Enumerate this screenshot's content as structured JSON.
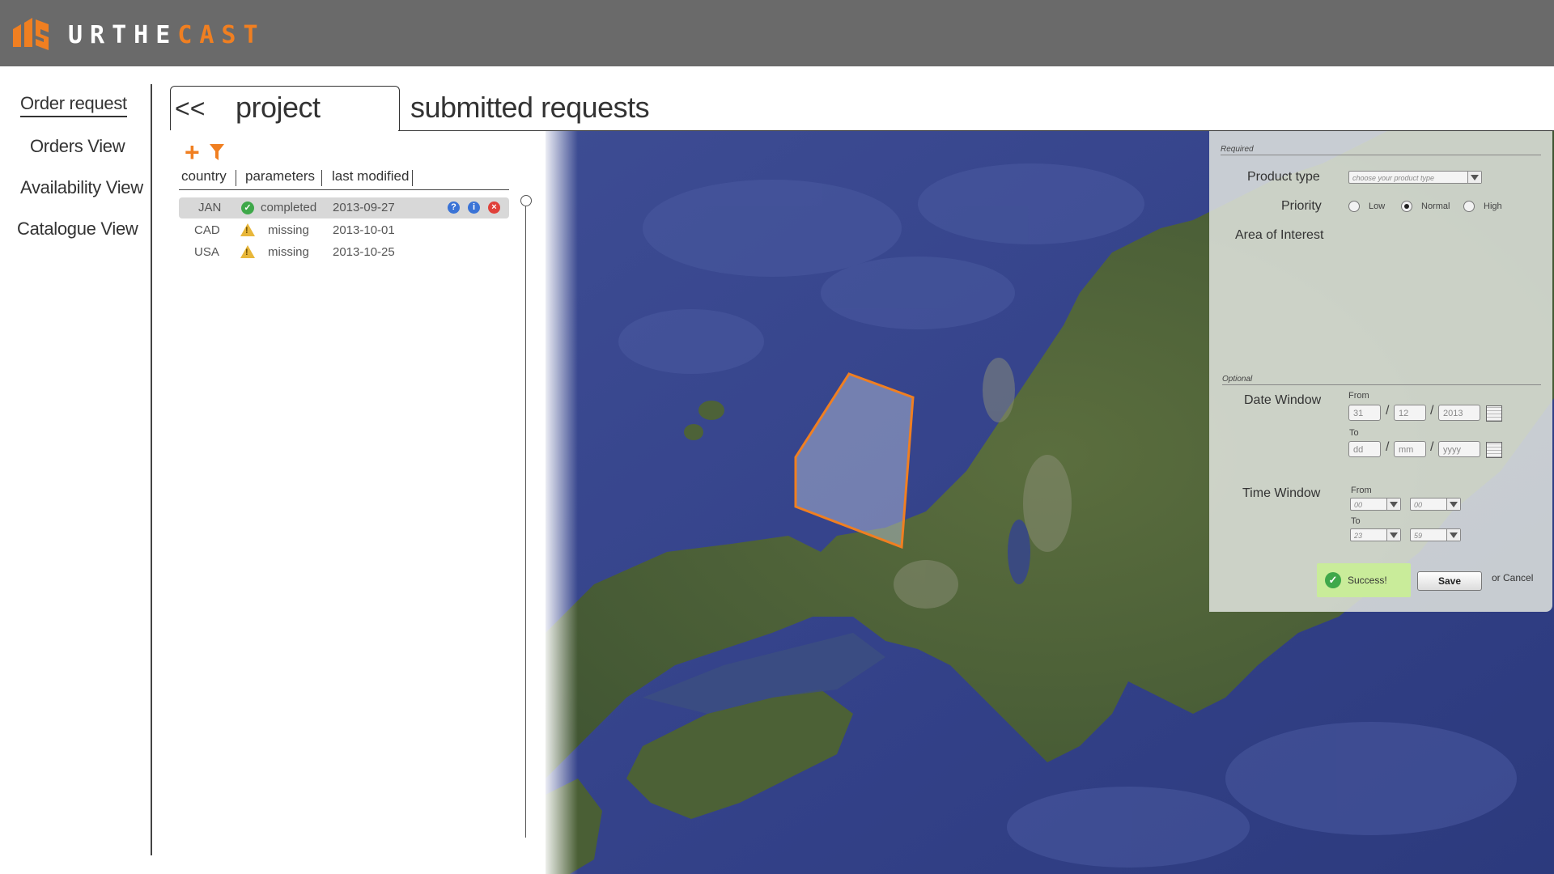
{
  "brand": {
    "logo_white": "URTHE",
    "logo_orange": "CAST",
    "accent": "#f07f21"
  },
  "nav": {
    "items": [
      {
        "label": "Order request",
        "active": true
      },
      {
        "label": "Orders View"
      },
      {
        "label": "Availability View"
      },
      {
        "label": "Catalogue View"
      }
    ]
  },
  "tabs": {
    "back": "<<",
    "project": "project",
    "submitted": "submitted requests"
  },
  "project": {
    "tools": {
      "add": "+",
      "filter_icon": "filter-icon"
    },
    "columns": [
      "country",
      "parameters",
      "last modified"
    ],
    "rows": [
      {
        "country": "JAN",
        "status": "completed",
        "status_icon": "check-icon",
        "modified": "2013-09-27",
        "selected": true
      },
      {
        "country": "CAD",
        "status": "missing",
        "status_icon": "warning-icon",
        "modified": "2013-10-01"
      },
      {
        "country": "USA",
        "status": "missing",
        "status_icon": "warning-icon",
        "modified": "2013-10-25"
      }
    ],
    "row_actions": [
      "help-icon",
      "info-icon",
      "delete-icon"
    ]
  },
  "form": {
    "required_label": "Required",
    "product_type_label": "Product type",
    "product_type_placeholder": "choose your product type",
    "priority_label": "Priority",
    "priority_options": [
      "Low",
      "Normal",
      "High"
    ],
    "priority_selected": "Normal",
    "aoi_label": "Area of Interest",
    "optional_label": "Optional",
    "date_window_label": "Date Window",
    "from_label": "From",
    "to_label": "To",
    "date_from": {
      "day": "31",
      "month": "12",
      "year": "2013"
    },
    "date_to": {
      "day": "dd",
      "month": "mm",
      "year": "yyyy"
    },
    "time_window_label": "Time Window",
    "time_from": {
      "hour": "00",
      "minute": "00"
    },
    "time_to": {
      "hour": "23",
      "minute": "59"
    },
    "success_text": "Success!",
    "save_label": "Save",
    "cancel_label": "or Cancel"
  },
  "colors": {
    "header_bg": "#6a6a6a",
    "polygon": "#f07f21",
    "success_bg": "#c9ec9a"
  }
}
